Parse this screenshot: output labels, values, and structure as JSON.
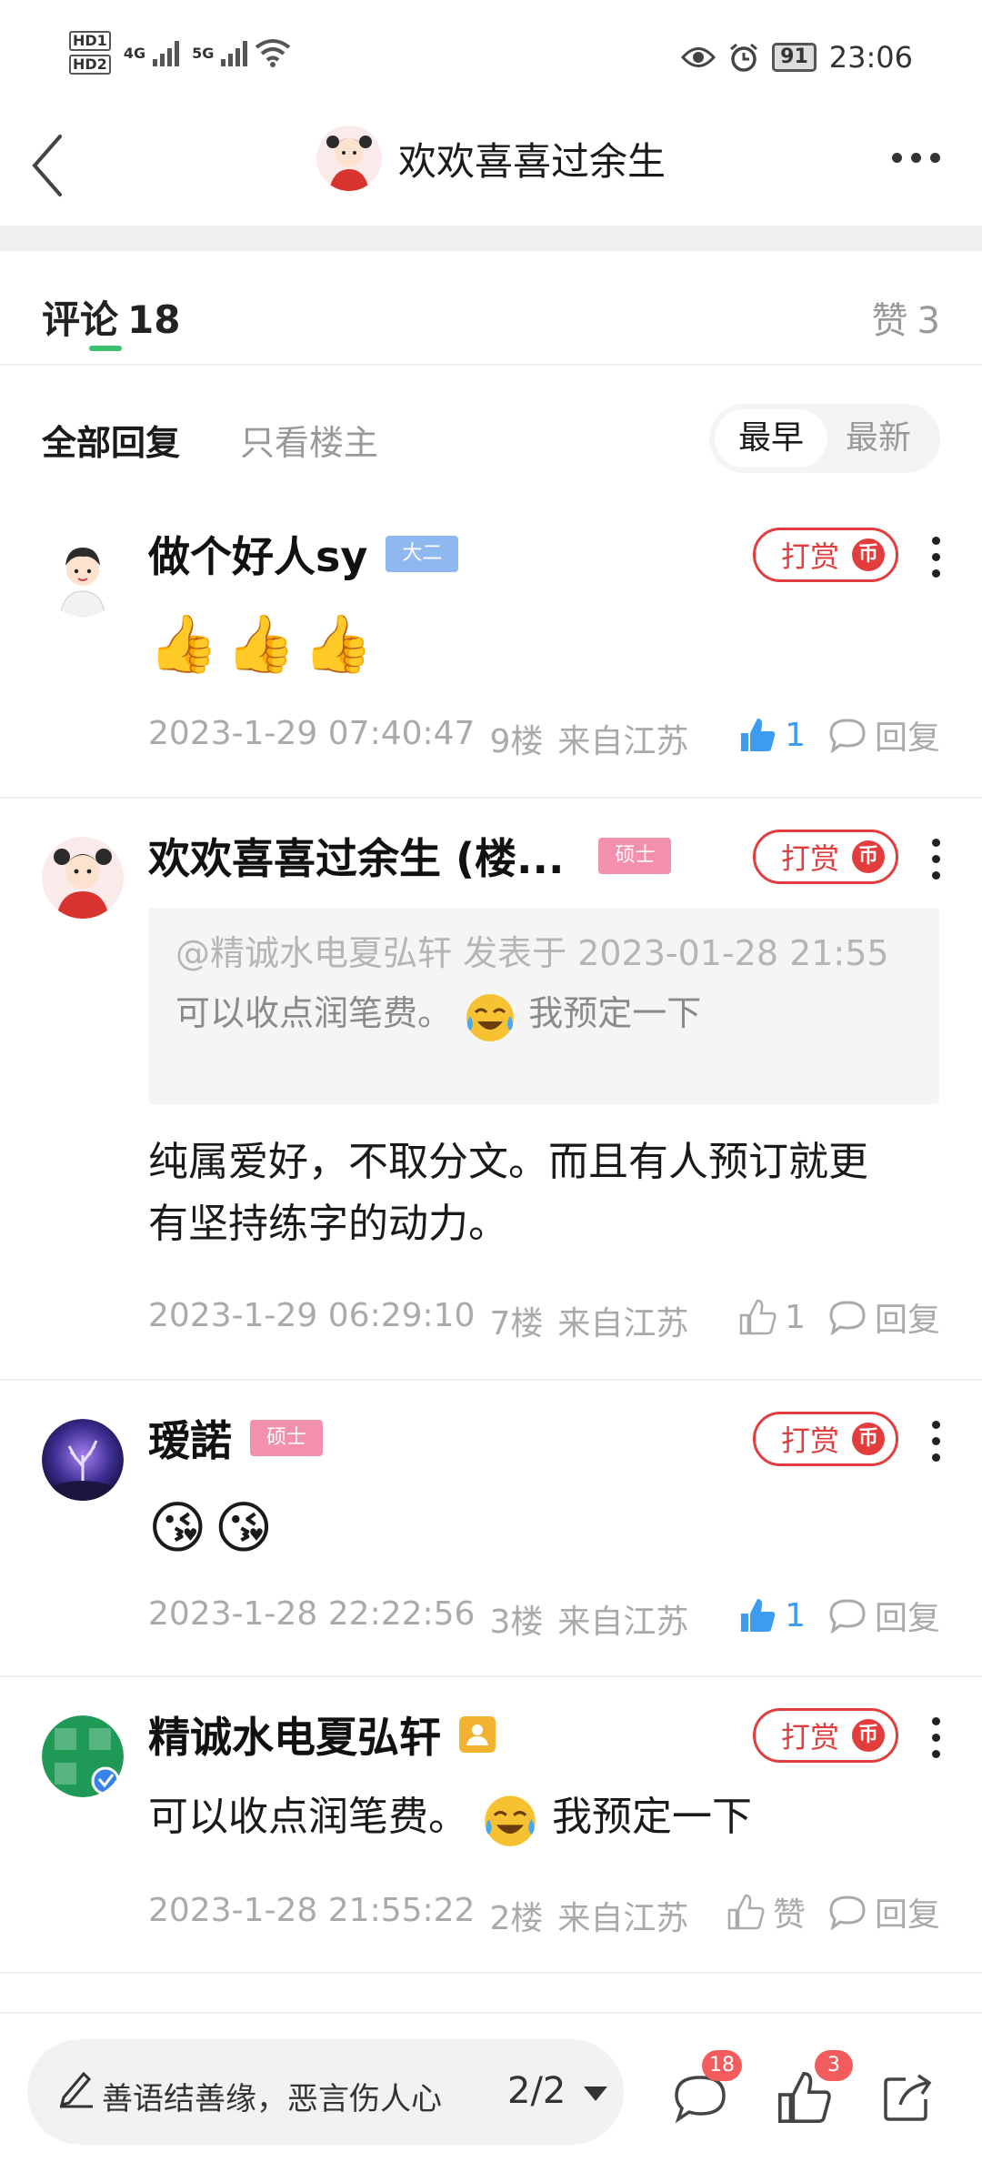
{
  "status_bar": {
    "hd1": "HD1",
    "hd2": "HD2",
    "net1": "4G",
    "net2": "5G",
    "battery": "91",
    "time": "23:06"
  },
  "header": {
    "title": "欢欢喜喜过余生"
  },
  "tabs": {
    "comments_label": "评论",
    "comments_count": "18",
    "likes_label": "赞",
    "likes_count": "3"
  },
  "filter": {
    "all_label": "全部回复",
    "owner_label": "只看楼主",
    "sort_earliest": "最早",
    "sort_latest": "最新"
  },
  "reward_label": "打赏",
  "reward_coin": "币",
  "reply_label": "回复",
  "comments": [
    {
      "name": "做个好人sy",
      "badge": "大二",
      "body": "👍👍👍",
      "date": "2023-1-29 07:40:47",
      "floor": "9楼",
      "location": "来自江苏",
      "like_text": "1",
      "liked": true
    },
    {
      "name": "欢欢喜喜过余生 (楼...",
      "badge": "硕士",
      "quote_header": "@精诚水电夏弘轩 发表于 2023-01-28 21:55",
      "quote_text_a": "可以收点润笔费。",
      "quote_text_b": "我预定一下",
      "body_line1": "纯属爱好，不取分文。而且有人预订就更",
      "body_line2": "有坚持练字的动力。",
      "date": "2023-1-29 06:29:10",
      "floor": "7楼",
      "location": "来自江苏",
      "like_text": "1",
      "liked": false
    },
    {
      "name": "瑷諾",
      "badge": "硕士",
      "body": "😘😘",
      "date": "2023-1-28 22:22:56",
      "floor": "3楼",
      "location": "来自江苏",
      "like_text": "1",
      "liked": true
    },
    {
      "name": "精诚水电夏弘轩",
      "body_a": "可以收点润笔费。",
      "body_b": "我预定一下",
      "date": "2023-1-28 21:55:22",
      "floor": "2楼",
      "location": "来自江苏",
      "like_text": "赞",
      "liked": false
    }
  ],
  "bottom_bar": {
    "placeholder": "善语结善缘，恶言伤人心",
    "page": "2/2",
    "comment_badge": "18",
    "like_badge": "3"
  },
  "colors": {
    "accent_green": "#3cc16f",
    "reward_red": "#e23c3c",
    "like_blue": "#3b9cf0"
  }
}
